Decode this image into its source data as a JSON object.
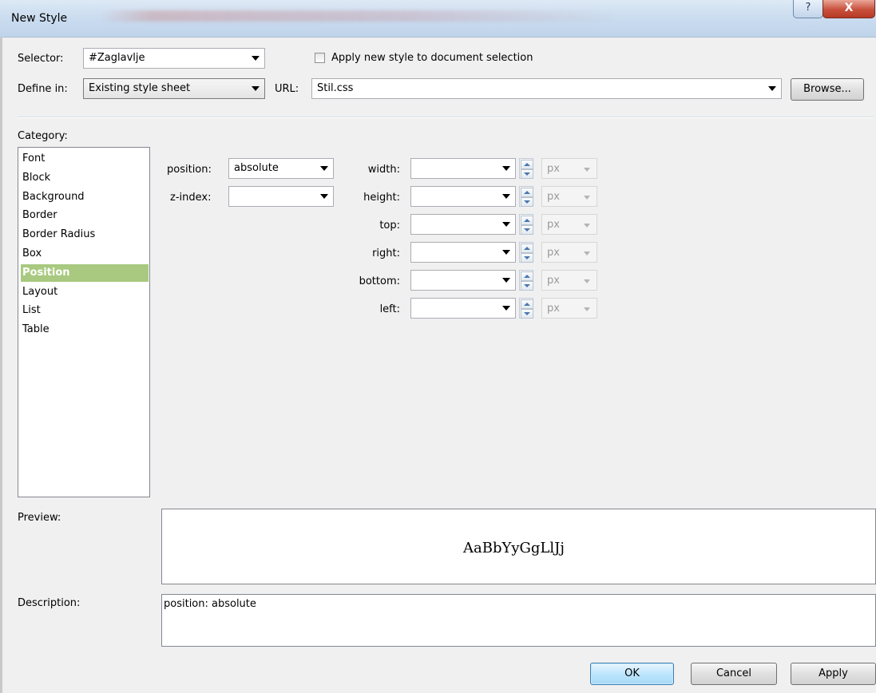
{
  "window": {
    "title": "New Style",
    "help_glyph": "?",
    "close_glyph": "X"
  },
  "selector": {
    "label": "Selector:",
    "value": "#Zaglavlje"
  },
  "apply_selection": {
    "label": "Apply new style to document selection",
    "checked": false
  },
  "define_in": {
    "label": "Define in:",
    "value": "Existing style sheet"
  },
  "url": {
    "label": "URL:",
    "value": "Stil.css"
  },
  "browse_label": "Browse...",
  "category": {
    "label": "Category:",
    "items": [
      "Font",
      "Block",
      "Background",
      "Border",
      "Border Radius",
      "Box",
      "Position",
      "Layout",
      "List",
      "Table"
    ],
    "selected": "Position",
    "selected_color": "#a8c97f"
  },
  "position_props": {
    "position": {
      "label": "position:",
      "value": "absolute"
    },
    "z_index": {
      "label": "z-index:",
      "value": ""
    }
  },
  "dimensions": [
    {
      "label": "width:",
      "value": "",
      "unit": "px"
    },
    {
      "label": "height:",
      "value": "",
      "unit": "px"
    },
    {
      "label": "top:",
      "value": "",
      "unit": "px"
    },
    {
      "label": "right:",
      "value": "",
      "unit": "px"
    },
    {
      "label": "bottom:",
      "value": "",
      "unit": "px"
    },
    {
      "label": "left:",
      "value": "",
      "unit": "px"
    }
  ],
  "preview": {
    "label": "Preview:",
    "sample": "AaBbYyGgLlJj"
  },
  "description": {
    "label": "Description:",
    "value": "position: absolute"
  },
  "buttons": {
    "ok": "OK",
    "cancel": "Cancel",
    "apply": "Apply"
  }
}
